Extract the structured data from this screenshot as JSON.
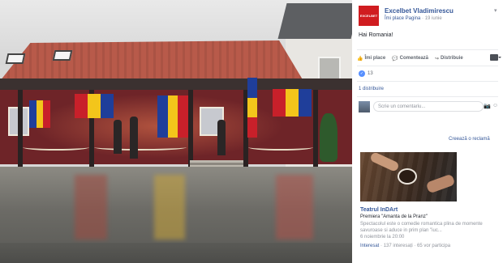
{
  "post": {
    "page_name": "Excelbet Vladimirescu",
    "page_avatar_text": "EXCELBET",
    "like_page_label": "Îmi place Pagina",
    "separator": "·",
    "date": "19 iunie",
    "text": "Hai Romania!"
  },
  "actions": {
    "like": "Îmi place",
    "comment": "Comentează",
    "share": "Distribuie"
  },
  "reactions": {
    "count": "13"
  },
  "shares": {
    "label": "1 distribuire"
  },
  "comment": {
    "placeholder": "Scrie un comentariu..."
  },
  "ads": {
    "create_label": "Creează o reclamă",
    "title": "Teatrul InDArt",
    "subtitle": "Premiera \"Amanta de la Pranz\"",
    "body_line1": "Spectacolul este o comedie romantica plina de momente",
    "body_line2": "savuroase si aduce in prim plan \"iuc...",
    "date": "6 noiembrie la 20:00",
    "interest_label": "Interesat",
    "stats": "· 137 interesați · 65 vor participa"
  },
  "icons": {
    "like": "thumbs-up-icon",
    "comment": "comment-icon",
    "share": "share-icon",
    "camera": "camera-icon",
    "sticker": "sticker-icon",
    "chevron": "chevron-down-icon"
  },
  "colors": {
    "link": "#365899",
    "brand_red": "#d01c20",
    "like_blue": "#5890ff"
  }
}
